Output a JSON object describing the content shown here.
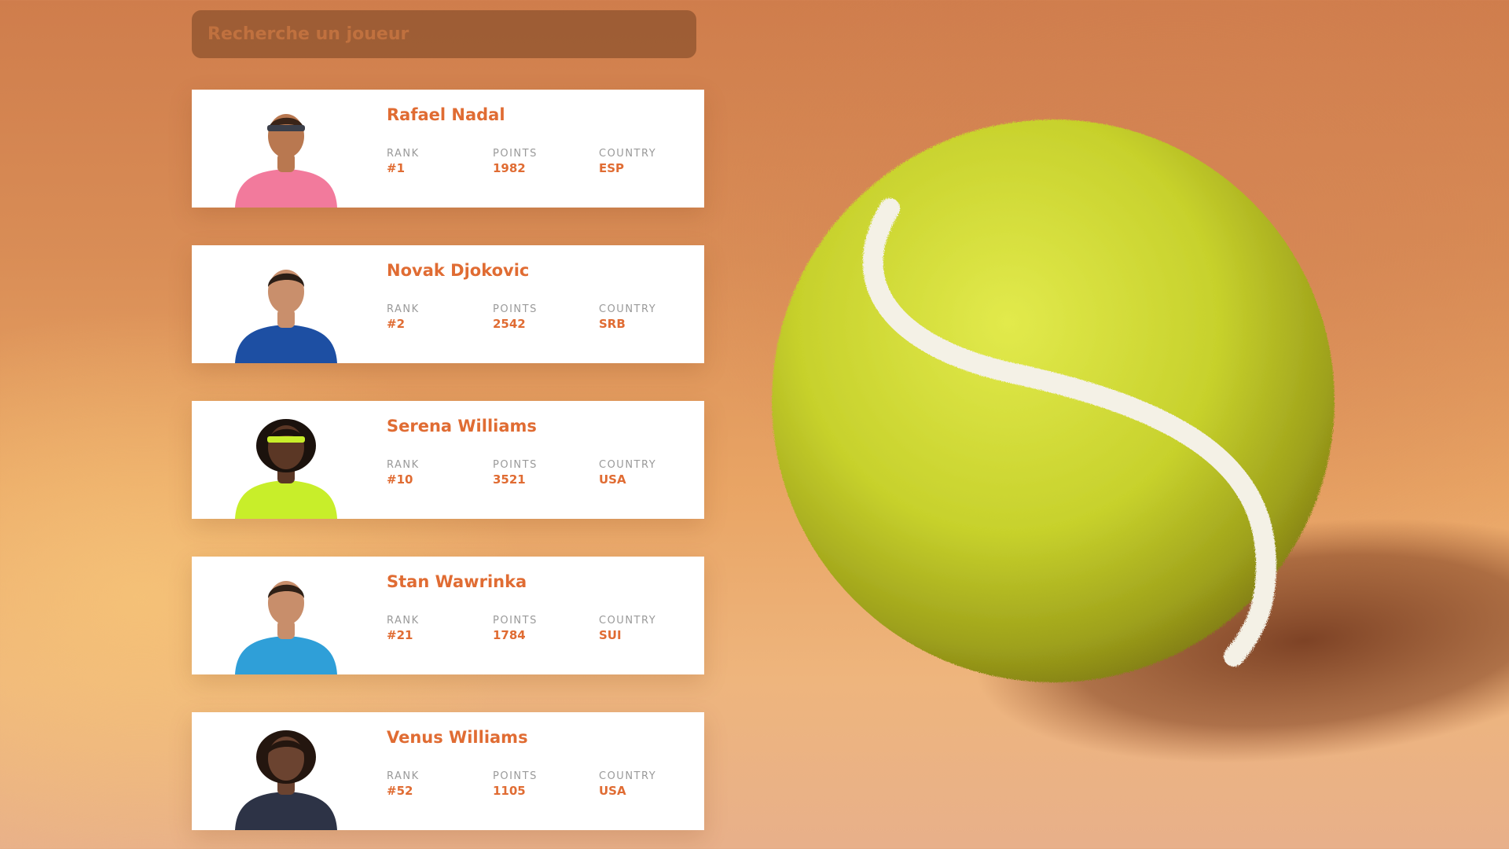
{
  "search": {
    "placeholder": "Recherche un joueur"
  },
  "labels": {
    "rank": "RANK",
    "points": "POINTS",
    "country": "COUNTRY"
  },
  "players": [
    {
      "name": "Rafael Nadal",
      "rank": "#1",
      "points": "1982",
      "country": "ESP",
      "shirt": "#f27a9c",
      "skin": "#b97850",
      "hair": "#3a2418",
      "band": "#3b3f4a"
    },
    {
      "name": "Novak Djokovic",
      "rank": "#2",
      "points": "2542",
      "country": "SRB",
      "shirt": "#1d4fa3",
      "skin": "#c98f6c",
      "hair": "#2b1e16",
      "band": ""
    },
    {
      "name": "Serena Williams",
      "rank": "#10",
      "points": "3521",
      "country": "USA",
      "shirt": "#c8ee2a",
      "skin": "#5b3725",
      "hair": "#1b120d",
      "band": "#c8ee2a"
    },
    {
      "name": "Stan Wawrinka",
      "rank": "#21",
      "points": "1784",
      "country": "SUI",
      "shirt": "#2f9fd8",
      "skin": "#c88e6b",
      "hair": "#2f2016",
      "band": ""
    },
    {
      "name": "Venus Williams",
      "rank": "#52",
      "points": "1105",
      "country": "USA",
      "shirt": "#2d3346",
      "skin": "#6b4330",
      "hair": "#24160f",
      "band": ""
    }
  ],
  "colors": {
    "accent": "#e06c33",
    "ball": "#c9d633",
    "ball_seam": "#f4f1e6"
  }
}
